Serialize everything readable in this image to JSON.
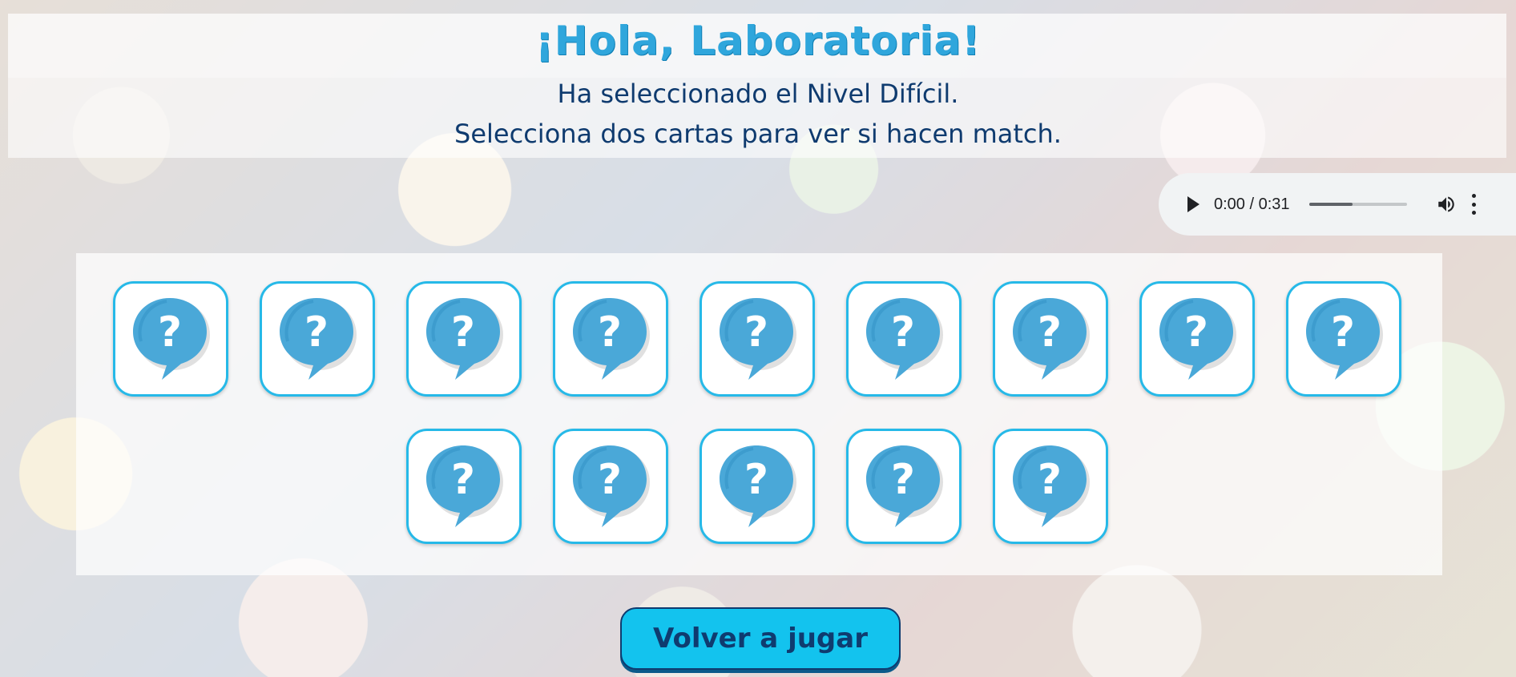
{
  "header": {
    "title": "¡Hola, Laboratoria!",
    "level_text": "Ha seleccionado el Nivel Difícil.",
    "instruction_text": "Selecciona dos cartas para ver si hacen match."
  },
  "audio_player": {
    "time": "0:00 / 0:31",
    "progress_fraction": 0.45,
    "play_icon": "play-icon",
    "volume_icon": "volume-icon",
    "menu_icon": "more-vert-icon"
  },
  "board": {
    "card_count": 14,
    "card_face": "question-bubble-icon",
    "accent_color": "#26b9e8",
    "bubble_color": "#4aa8d8"
  },
  "actions": {
    "replay_label": "Volver a jugar"
  }
}
